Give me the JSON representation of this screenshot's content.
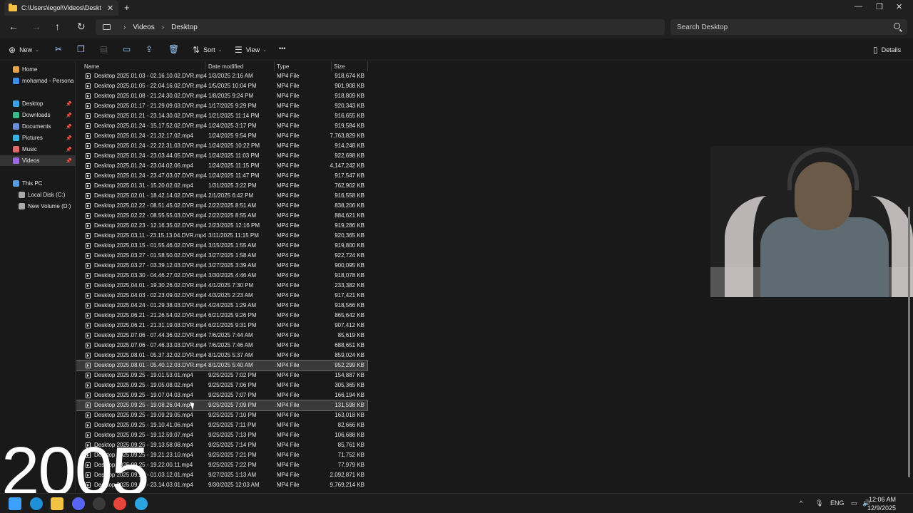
{
  "window": {
    "tab_title": "C:\\Users\\legol\\Videos\\Deskto",
    "tab_close": "✕",
    "new_tab": "+",
    "minimize": "—",
    "maximize": "❐",
    "close": "✕"
  },
  "nav": {
    "back": "←",
    "forward": "→",
    "up": "↑",
    "refresh": "↻",
    "breadcrumb": [
      "Videos",
      "Desktop"
    ],
    "breadcrumb_sep": "›",
    "search_placeholder": "Search Desktop"
  },
  "commands": {
    "new": "New",
    "sort": "Sort",
    "view": "View",
    "more": "•••",
    "details": "Details"
  },
  "sidebar": {
    "items": [
      {
        "label": "Home",
        "color": "#e8a14b"
      },
      {
        "label": "mohamad - Persona",
        "color": "#3b8ee8"
      },
      {
        "label": "Desktop",
        "color": "#3aa0e8",
        "pinned": true
      },
      {
        "label": "Downloads",
        "color": "#3ab88a",
        "pinned": true
      },
      {
        "label": "Documents",
        "color": "#6a8ed8",
        "pinned": true
      },
      {
        "label": "Pictures",
        "color": "#3ab0e0",
        "pinned": true
      },
      {
        "label": "Music",
        "color": "#e06a6a",
        "pinned": true
      },
      {
        "label": "Videos",
        "color": "#9a6ae0",
        "pinned": true,
        "selected": true
      },
      {
        "label": "This PC",
        "color": "#5a9ae0"
      },
      {
        "label": "Local Disk (C:)",
        "color": "#aaaaaa"
      },
      {
        "label": "New Volume (D:)",
        "color": "#aaaaaa"
      }
    ]
  },
  "columns": {
    "name": "Name",
    "date": "Date modified",
    "type": "Type",
    "size": "Size"
  },
  "files": [
    {
      "name": "Desktop 2025.01.03 - 02.16.10.02.DVR.mp4",
      "date": "1/3/2025 2:16 AM",
      "type": "MP4 File",
      "size": "918,674 KB"
    },
    {
      "name": "Desktop 2025.01.05 - 22.04.16.02.DVR.mp4",
      "date": "1/5/2025 10:04 PM",
      "type": "MP4 File",
      "size": "901,908 KB"
    },
    {
      "name": "Desktop 2025.01.08 - 21.24.30.02.DVR.mp4",
      "date": "1/8/2025 9:24 PM",
      "type": "MP4 File",
      "size": "918,809 KB"
    },
    {
      "name": "Desktop 2025.01.17 - 21.29.09.03.DVR.mp4",
      "date": "1/17/2025 9:29 PM",
      "type": "MP4 File",
      "size": "920,343 KB"
    },
    {
      "name": "Desktop 2025.01.21 - 23.14.30.02.DVR.mp4",
      "date": "1/21/2025 11:14 PM",
      "type": "MP4 File",
      "size": "916,655 KB"
    },
    {
      "name": "Desktop 2025.01.24 - 15.17.52.02.DVR.mp4",
      "date": "1/24/2025 3:17 PM",
      "type": "MP4 File",
      "size": "919,584 KB"
    },
    {
      "name": "Desktop 2025.01.24 - 21.32.17.02.mp4",
      "date": "1/24/2025 9:54 PM",
      "type": "MP4 File",
      "size": "7,763,829 KB"
    },
    {
      "name": "Desktop 2025.01.24 - 22.22.31.03.DVR.mp4",
      "date": "1/24/2025 10:22 PM",
      "type": "MP4 File",
      "size": "914,248 KB"
    },
    {
      "name": "Desktop 2025.01.24 - 23.03.44.05.DVR.mp4",
      "date": "1/24/2025 11:03 PM",
      "type": "MP4 File",
      "size": "922,698 KB"
    },
    {
      "name": "Desktop 2025.01.24 - 23.04.02.06.mp4",
      "date": "1/24/2025 11:15 PM",
      "type": "MP4 File",
      "size": "4,147,242 KB"
    },
    {
      "name": "Desktop 2025.01.24 - 23.47.03.07.DVR.mp4",
      "date": "1/24/2025 11:47 PM",
      "type": "MP4 File",
      "size": "917,547 KB"
    },
    {
      "name": "Desktop 2025.01.31 - 15.20.02.02.mp4",
      "date": "1/31/2025 3:22 PM",
      "type": "MP4 File",
      "size": "762,902 KB"
    },
    {
      "name": "Desktop 2025.02.01 - 18.42.14.02.DVR.mp4",
      "date": "2/1/2025 6:42 PM",
      "type": "MP4 File",
      "size": "916,558 KB"
    },
    {
      "name": "Desktop 2025.02.22 - 08.51.45.02.DVR.mp4",
      "date": "2/22/2025 8:51 AM",
      "type": "MP4 File",
      "size": "838,206 KB"
    },
    {
      "name": "Desktop 2025.02.22 - 08.55.55.03.DVR.mp4",
      "date": "2/22/2025 8:55 AM",
      "type": "MP4 File",
      "size": "884,621 KB"
    },
    {
      "name": "Desktop 2025.02.23 - 12.16.35.02.DVR.mp4",
      "date": "2/23/2025 12:16 PM",
      "type": "MP4 File",
      "size": "919,286 KB"
    },
    {
      "name": "Desktop 2025.03.11 - 23.15.13.04.DVR.mp4",
      "date": "3/11/2025 11:15 PM",
      "type": "MP4 File",
      "size": "920,365 KB"
    },
    {
      "name": "Desktop 2025.03.15 - 01.55.46.02.DVR.mp4",
      "date": "3/15/2025 1:55 AM",
      "type": "MP4 File",
      "size": "919,800 KB"
    },
    {
      "name": "Desktop 2025.03.27 - 01.58.50.02.DVR.mp4",
      "date": "3/27/2025 1:58 AM",
      "type": "MP4 File",
      "size": "922,724 KB"
    },
    {
      "name": "Desktop 2025.03.27 - 03.39.12.03.DVR.mp4",
      "date": "3/27/2025 3:39 AM",
      "type": "MP4 File",
      "size": "900,095 KB"
    },
    {
      "name": "Desktop 2025.03.30 - 04.46.27.02.DVR.mp4",
      "date": "3/30/2025 4:46 AM",
      "type": "MP4 File",
      "size": "918,078 KB"
    },
    {
      "name": "Desktop 2025.04.01 - 19.30.26.02.DVR.mp4",
      "date": "4/1/2025 7:30 PM",
      "type": "MP4 File",
      "size": "233,382 KB"
    },
    {
      "name": "Desktop 2025.04.03 - 02.23.09.02.DVR.mp4",
      "date": "4/3/2025 2:23 AM",
      "type": "MP4 File",
      "size": "917,421 KB"
    },
    {
      "name": "Desktop 2025.04.24 - 01.29.38.03.DVR.mp4",
      "date": "4/24/2025 1:29 AM",
      "type": "MP4 File",
      "size": "918,566 KB"
    },
    {
      "name": "Desktop 2025.06.21 - 21.26.54.02.DVR.mp4",
      "date": "6/21/2025 9:26 PM",
      "type": "MP4 File",
      "size": "865,642 KB"
    },
    {
      "name": "Desktop 2025.06.21 - 21.31.19.03.DVR.mp4",
      "date": "6/21/2025 9:31 PM",
      "type": "MP4 File",
      "size": "907,412 KB"
    },
    {
      "name": "Desktop 2025.07.06 - 07.44.36.02.DVR.mp4",
      "date": "7/6/2025 7:44 AM",
      "type": "MP4 File",
      "size": "85,619 KB"
    },
    {
      "name": "Desktop 2025.07.06 - 07.46.33.03.DVR.mp4",
      "date": "7/6/2025 7:46 AM",
      "type": "MP4 File",
      "size": "688,651 KB"
    },
    {
      "name": "Desktop 2025.08.01 - 05.37.32.02.DVR.mp4",
      "date": "8/1/2025 5:37 AM",
      "type": "MP4 File",
      "size": "859,024 KB"
    },
    {
      "name": "Desktop 2025.08.01 - 05.40.12.03.DVR.mp4",
      "date": "8/1/2025 5:40 AM",
      "type": "MP4 File",
      "size": "952,299 KB",
      "selected": true
    },
    {
      "name": "Desktop 2025.09.25 - 19.01.53.01.mp4",
      "date": "9/25/2025 7:02 PM",
      "type": "MP4 File",
      "size": "154,887 KB"
    },
    {
      "name": "Desktop 2025.09.25 - 19.05.08.02.mp4",
      "date": "9/25/2025 7:06 PM",
      "type": "MP4 File",
      "size": "305,365 KB"
    },
    {
      "name": "Desktop 2025.09.25 - 19.07.04.03.mp4",
      "date": "9/25/2025 7:07 PM",
      "type": "MP4 File",
      "size": "166,194 KB"
    },
    {
      "name": "Desktop 2025.09.25 - 19.08.26.04.mp4",
      "date": "9/25/2025 7:09 PM",
      "type": "MP4 File",
      "size": "131,598 KB",
      "hover": true
    },
    {
      "name": "Desktop 2025.09.25 - 19.09.29.05.mp4",
      "date": "9/25/2025 7:10 PM",
      "type": "MP4 File",
      "size": "163,018 KB"
    },
    {
      "name": "Desktop 2025.09.25 - 19.10.41.06.mp4",
      "date": "9/25/2025 7:11 PM",
      "type": "MP4 File",
      "size": "82,666 KB"
    },
    {
      "name": "Desktop 2025.09.25 - 19.12.59.07.mp4",
      "date": "9/25/2025 7:13 PM",
      "type": "MP4 File",
      "size": "106,688 KB"
    },
    {
      "name": "Desktop 2025.09.25 - 19.13.58.08.mp4",
      "date": "9/25/2025 7:14 PM",
      "type": "MP4 File",
      "size": "85,761 KB"
    },
    {
      "name": "Desktop 2025.09.25 - 19.21.23.10.mp4",
      "date": "9/25/2025 7:21 PM",
      "type": "MP4 File",
      "size": "71,752 KB"
    },
    {
      "name": "Desktop 2025.09.25 - 19.22.00.11.mp4",
      "date": "9/25/2025 7:22 PM",
      "type": "MP4 File",
      "size": "77,979 KB"
    },
    {
      "name": "Desktop 2025.09.27 - 01.03.12.01.mp4",
      "date": "9/27/2025 1:13 AM",
      "type": "MP4 File",
      "size": "2,092,871 KB"
    },
    {
      "name": "Desktop 2025.09.29 - 23.14.03.01.mp4",
      "date": "9/30/2025 12:03 AM",
      "type": "MP4 File",
      "size": "9,769,214 KB"
    }
  ],
  "overlay_year": "2005",
  "taskbar": {
    "language": "ENG",
    "time": "12:06 AM",
    "date": "12/9/2025",
    "tray_up": "^",
    "apps": [
      {
        "name": "start",
        "color": "#3ba0ff"
      },
      {
        "name": "edge",
        "color": "#1f8fd8"
      },
      {
        "name": "file-explorer",
        "color": "#f3c244"
      },
      {
        "name": "discord",
        "color": "#5865f2"
      },
      {
        "name": "steam",
        "color": "#3a3a3a"
      },
      {
        "name": "chrome",
        "color": "#e8453c"
      },
      {
        "name": "telegram",
        "color": "#2aa3e0"
      }
    ]
  }
}
